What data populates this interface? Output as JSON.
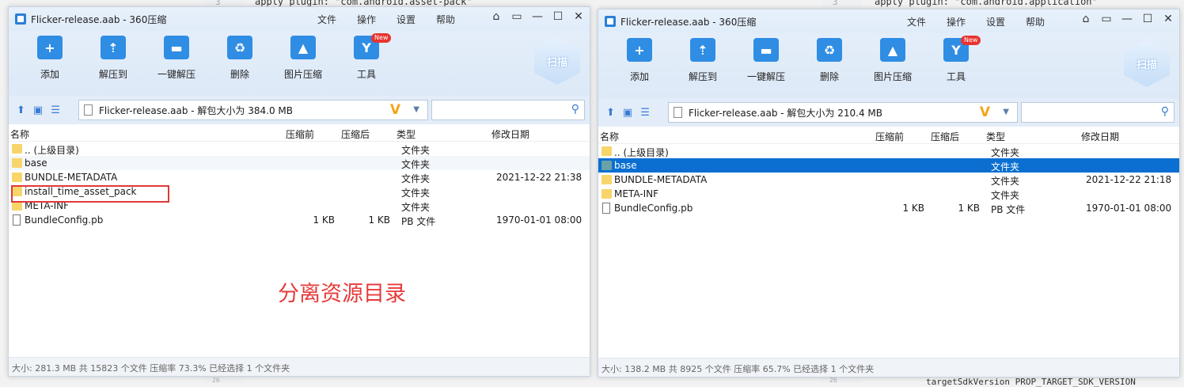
{
  "background": {
    "left_code": "apply plugin: \"com.android.asset-pack\"",
    "right_code": "apply plugin: \"com.android.application\"",
    "bottom_right_code": "targetSdkVersion PROP_TARGET_SDK_VERSION",
    "left_gutter_top": "3",
    "right_gutter_top": "3",
    "left_gutter_bottom": "26",
    "right_gutter_bottom": "26"
  },
  "menus": [
    "文件",
    "操作",
    "设置",
    "帮助"
  ],
  "tools": [
    {
      "label": "添加",
      "icon": "add-icon",
      "glyph": "+"
    },
    {
      "label": "解压到",
      "icon": "extract-to-icon",
      "glyph": "⇡"
    },
    {
      "label": "一键解压",
      "icon": "one-click-extract-icon",
      "glyph": "▬"
    },
    {
      "label": "删除",
      "icon": "delete-icon",
      "glyph": "♻"
    },
    {
      "label": "图片压缩",
      "icon": "image-compress-icon",
      "glyph": "▲"
    },
    {
      "label": "工具",
      "icon": "tools-icon",
      "glyph": "Y"
    }
  ],
  "new_badge": "New",
  "scan_label": "扫描",
  "columns": {
    "name": "名称",
    "before": "压缩前",
    "after": "压缩后",
    "type": "类型",
    "date": "修改日期"
  },
  "windows": [
    {
      "title": "Flicker-release.aab - 360压缩",
      "address": "Flicker-release.aab - 解包大小为 384.0 MB",
      "rows": [
        {
          "name": ".. (上级目录)",
          "before": "",
          "after": "",
          "type": "文件夹",
          "date": "",
          "kind": "folder"
        },
        {
          "name": "base",
          "before": "",
          "after": "",
          "type": "文件夹",
          "date": "",
          "kind": "folder"
        },
        {
          "name": "BUNDLE-METADATA",
          "before": "",
          "after": "",
          "type": "文件夹",
          "date": "2021-12-22 21:38",
          "kind": "folder"
        },
        {
          "name": "install_time_asset_pack",
          "before": "",
          "after": "",
          "type": "文件夹",
          "date": "",
          "kind": "folder"
        },
        {
          "name": "META-INF",
          "before": "",
          "after": "",
          "type": "文件夹",
          "date": "",
          "kind": "folder"
        },
        {
          "name": "BundleConfig.pb",
          "before": "1 KB",
          "after": "1 KB",
          "type": "PB 文件",
          "date": "1970-01-01 08:00",
          "kind": "file"
        }
      ],
      "status": "大小: 281.3 MB 共 15823 个文件 压缩率 73.3% 已经选择 1 个文件夹",
      "annotation": "分离资源目录"
    },
    {
      "title": "Flicker-release.aab - 360压缩",
      "address": "Flicker-release.aab - 解包大小为 210.4 MB",
      "rows": [
        {
          "name": ".. (上级目录)",
          "before": "",
          "after": "",
          "type": "文件夹",
          "date": "",
          "kind": "folder"
        },
        {
          "name": "base",
          "before": "",
          "after": "",
          "type": "文件夹",
          "date": "",
          "kind": "folder",
          "selected": true
        },
        {
          "name": "BUNDLE-METADATA",
          "before": "",
          "after": "",
          "type": "文件夹",
          "date": "2021-12-22 21:18",
          "kind": "folder"
        },
        {
          "name": "META-INF",
          "before": "",
          "after": "",
          "type": "文件夹",
          "date": "",
          "kind": "folder"
        },
        {
          "name": "BundleConfig.pb",
          "before": "1 KB",
          "after": "1 KB",
          "type": "PB 文件",
          "date": "1970-01-01 08:00",
          "kind": "file"
        }
      ],
      "status": "大小: 138.2 MB 共 8925 个文件 压缩率 65.7% 已经选择 1 个文件夹"
    }
  ]
}
